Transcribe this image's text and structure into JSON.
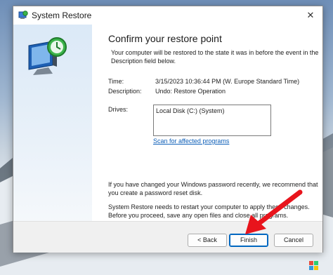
{
  "window": {
    "title": "System Restore",
    "close_glyph": "✕"
  },
  "page": {
    "heading": "Confirm your restore point",
    "intro": "Your computer will be restored to the state it was in before the event in the Description field below."
  },
  "details": {
    "time_label": "Time:",
    "time_value": "3/15/2023 10:36:44 PM (W. Europe Standard Time)",
    "description_label": "Description:",
    "description_value": "Undo: Restore Operation",
    "drives_label": "Drives:",
    "drives": [
      "Local Disk (C:) (System)"
    ],
    "scan_link": "Scan for affected programs"
  },
  "notices": {
    "password": "If you have changed your Windows password recently, we recommend that you create a password reset disk.",
    "restart": "System Restore needs to restart your computer to apply these changes. Before you proceed, save any open files and close all programs."
  },
  "buttons": {
    "back": "< Back",
    "finish": "Finish",
    "cancel": "Cancel"
  },
  "colors": {
    "accent": "#0067c0",
    "link": "#0b5db7",
    "annotation_arrow": "#e8141c"
  }
}
